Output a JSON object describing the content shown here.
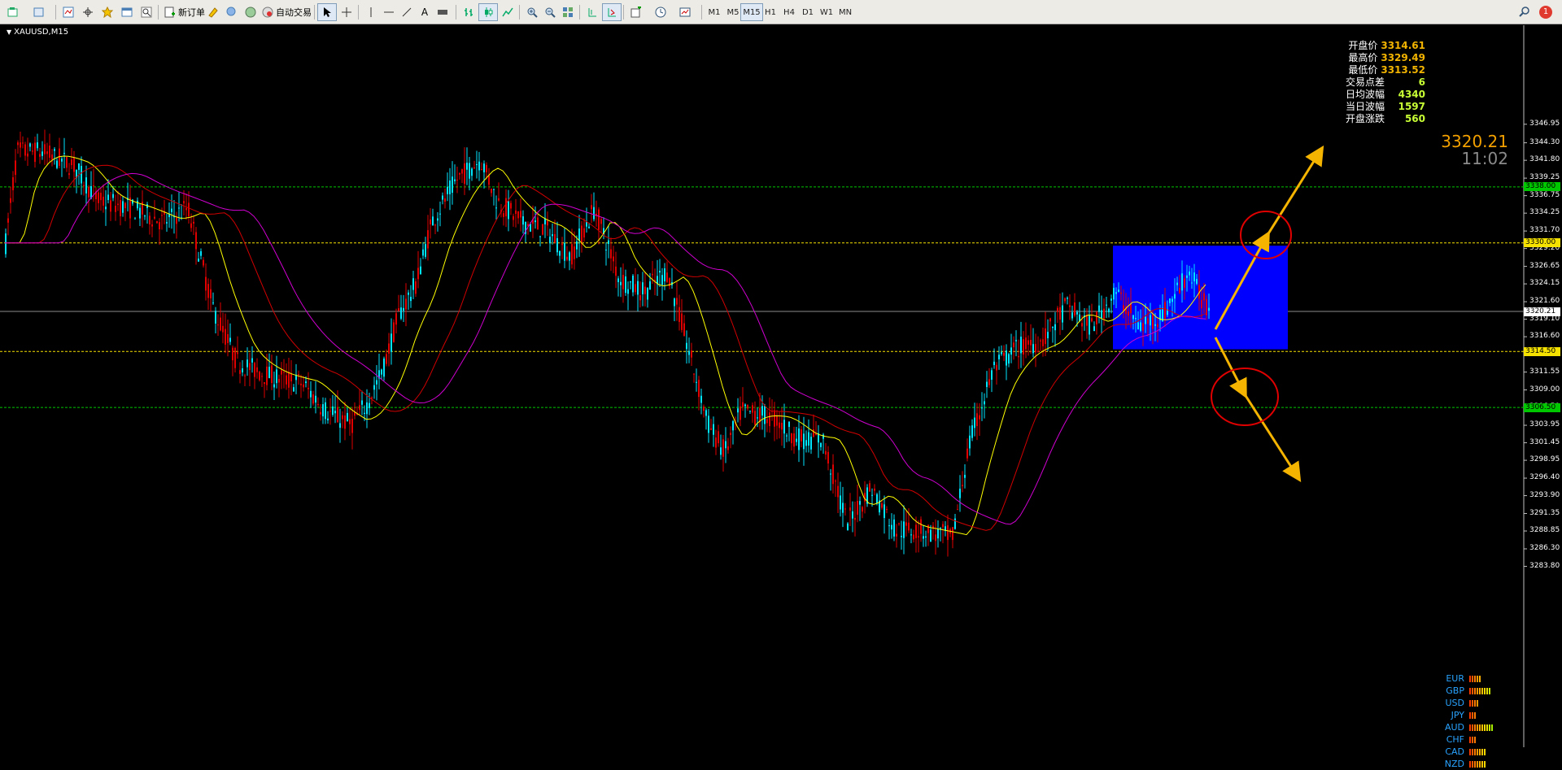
{
  "toolbar": {
    "new_order_label": "新订单",
    "auto_trade_label": "自动交易",
    "timeframes": [
      "M1",
      "M5",
      "M15",
      "H1",
      "H4",
      "D1",
      "W1",
      "MN"
    ],
    "active_timeframe": "M15",
    "notification_count": "1"
  },
  "chart": {
    "symbol": "XAUUSD,M15",
    "current_price": "3320.21",
    "clock": "11:02",
    "stats": [
      {
        "label": "开盘价",
        "value": "3314.61",
        "color": "#f2b400"
      },
      {
        "label": "最高价",
        "value": "3329.49",
        "color": "#f2b400"
      },
      {
        "label": "最低价",
        "value": "3313.52",
        "color": "#f2b400"
      },
      {
        "label": "交易点差",
        "value": "6",
        "color": "#c8ff35"
      },
      {
        "label": "日均波幅",
        "value": "4340",
        "color": "#c8ff35"
      },
      {
        "label": "当日波幅",
        "value": "1597",
        "color": "#c8ff35"
      },
      {
        "label": "开盘涨跌",
        "value": "560",
        "color": "#c8ff35"
      }
    ],
    "price_ticks": [
      "3346.95",
      "3344.30",
      "3341.80",
      "3339.25",
      "3336.75",
      "3334.25",
      "3331.70",
      "3329.20",
      "3326.65",
      "3324.15",
      "3321.60",
      "3319.10",
      "3316.60",
      "3314.05",
      "3311.55",
      "3309.00",
      "3306.50",
      "3303.95",
      "3301.45",
      "3298.95",
      "3296.40",
      "3293.90",
      "3291.35",
      "3288.85",
      "3286.30",
      "3283.80"
    ],
    "level_tags": [
      {
        "price": "3338.00",
        "value": 3338.0,
        "bg": "#00c800",
        "fg": "#000"
      },
      {
        "price": "3330.00",
        "value": 3330.0,
        "bg": "#f5e200",
        "fg": "#000"
      },
      {
        "price": "3320.21",
        "value": 3320.21,
        "bg": "#ffffff",
        "fg": "#000"
      },
      {
        "price": "3314.50",
        "value": 3314.5,
        "bg": "#f5e200",
        "fg": "#000"
      },
      {
        "price": "3306.50",
        "value": 3306.5,
        "bg": "#00c800",
        "fg": "#000"
      }
    ],
    "currency_strength": [
      {
        "name": "EUR",
        "bars": 5
      },
      {
        "name": "GBP",
        "bars": 9
      },
      {
        "name": "USD",
        "bars": 4
      },
      {
        "name": "JPY",
        "bars": 3
      },
      {
        "name": "AUD",
        "bars": 10
      },
      {
        "name": "CHF",
        "bars": 3
      },
      {
        "name": "CAD",
        "bars": 7
      },
      {
        "name": "NZD",
        "bars": 7
      }
    ],
    "colors": {
      "bull_candle": "#00e5ff",
      "bear_candle": "#e00000",
      "ma_fast": "#ffff00",
      "ma_mid": "#d00000",
      "ma_slow": "#d000d0",
      "box": "#0000ff",
      "arrow": "#f5b400",
      "circle": "#e00000"
    }
  }
}
